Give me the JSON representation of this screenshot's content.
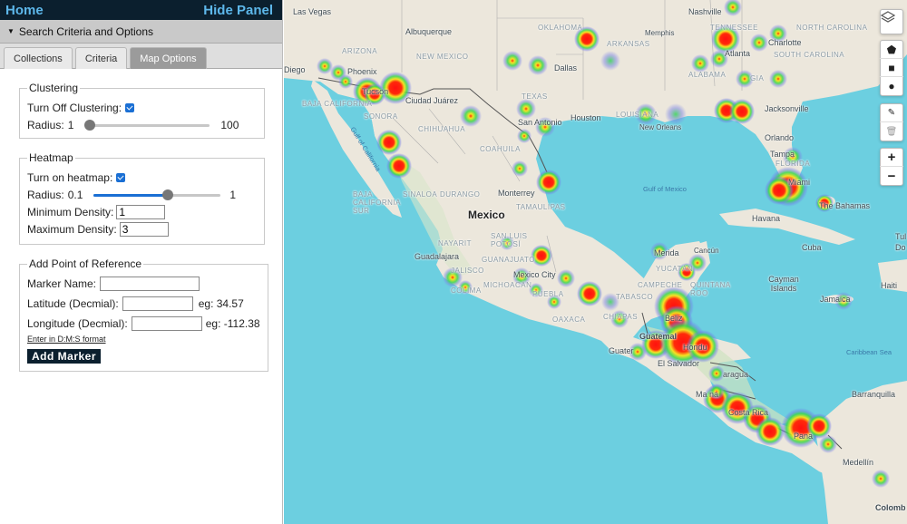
{
  "topbar": {
    "home": "Home",
    "hide_panel": "Hide Panel"
  },
  "search_header": "Search Criteria and Options",
  "tabs": [
    "Collections",
    "Criteria",
    "Map Options"
  ],
  "active_tab": 2,
  "clustering": {
    "legend": "Clustering",
    "turn_off_label": "Turn Off Clustering:",
    "turn_off_checked": true,
    "radius_label": "Radius:",
    "radius_min": "1",
    "radius_max": "100",
    "radius_value_fraction": 0.0
  },
  "heatmap": {
    "legend": "Heatmap",
    "turn_on_label": "Turn on heatmap:",
    "turn_on_checked": true,
    "radius_label": "Radius:",
    "radius_min": "0.1",
    "radius_max": "1",
    "radius_value_fraction": 0.58,
    "min_density_label": "Minimum Density:",
    "min_density_value": "1",
    "max_density_label": "Maximum Density:",
    "max_density_value": "3"
  },
  "reference": {
    "legend": "Add Point of Reference",
    "marker_name_label": "Marker Name:",
    "latitude_label": "Latitude (Decmial):",
    "latitude_eg": "eg: 34.57",
    "longitude_label": "Longitude (Decmial):",
    "longitude_eg": "eg: -112.38",
    "dms_link": "Enter in D:M:S format",
    "add_button": "Add Marker"
  },
  "map": {
    "water_color": "#6ccfe0",
    "land_color": "#ece7dc",
    "labels": {
      "las_vegas": "Las Vegas",
      "albuquerque": "Albuquerque",
      "nashville": "Nashville",
      "oklahoma": "OKLAHOMA",
      "tennessee": "TENNESSEE",
      "memphis": "Memphis",
      "north_carolina": "NORTH CAROLINA",
      "charlotte": "Charlotte",
      "arizona": "ARIZONA",
      "new_mexico": "NEW MEXICO",
      "arkansas": "ARKANSAS",
      "phoenix": "Phoenix",
      "dallas": "Dallas",
      "atlanta": "Atlanta",
      "south_carolina": "SOUTH CAROLINA",
      "alabama": "ALABAMA",
      "georgia": "GIA",
      "tucson": "Tucson",
      "ciudad_juarez": "Ciudad Juárez",
      "texas": "TEXAS",
      "diego": "Diego",
      "baja_california": "BAJA CALIFORNIA",
      "sonora": "SONORA",
      "chihuahua": "CHIHUAHUA",
      "san_antonio": "San Antonio",
      "houston": "Houston",
      "louisiana": "LOUISIANA",
      "new_orleans": "New Orleans",
      "jacksonville": "Jacksonville",
      "coahuila": "COAHUILA",
      "orlando": "Orlando",
      "gulf_of_california": "Gulf of California",
      "tampa": "Tampa",
      "florida": "FLORIDA",
      "baja_california_sur": "BAJA CALIFORNIA SUR",
      "sinaloa": "SINALOA",
      "durango": "DURANGO",
      "monterrey": "Monterrey",
      "gulf_of_mexico": "Gulf of Mexico",
      "miami": "Miami",
      "the_bahamas": "The Bahamas",
      "tamaulipas": "TAMAULIPAS",
      "mexico": "Mexico",
      "havana": "Havana",
      "cuba": "Cuba",
      "nayarit": "NAYARIT",
      "san_luis_potosi": "SAN LUIS POTOSÍ",
      "guadalajara": "Guadalajara",
      "jalisco": "JALISCO",
      "guanajuato": "GUANAJUATO",
      "merida": "Merida",
      "cancun": "Cancún",
      "yucatan": "YUCATÁN",
      "mexico_city": "Mexico City",
      "michoacan": "MICHOACÁN",
      "colima": "COLIMA",
      "puebla": "PUEBLA",
      "campeche": "CAMPECHE",
      "quintana_roo": "QUINTANA ROO",
      "tabasco": "TABASCO",
      "cayman_islands": "Cayman Islands",
      "jamaica": "Jamaica",
      "haiti": "Haiti",
      "oaxaca": "OAXACA",
      "chiapas": "CHIAPAS",
      "guatemala": "Guatemal",
      "belize": "Beliz",
      "honduras": "Hondu",
      "guater": "Guater",
      "el_salvador": "El Salvador",
      "nicaragua": "aragua",
      "caribbean_sea": "Caribbean Sea",
      "managua": "Ma na",
      "barranquilla": "Barranquilla",
      "costa_rica": "Costa Rica",
      "panama": "Pana",
      "medellin": "Medellín",
      "colombia": "Colomb",
      "tul": "Tul",
      "dom": "Do"
    }
  },
  "icons": {
    "layers": "layers-icon",
    "pentagon": "polygon-draw-icon",
    "square": "rectangle-draw-icon",
    "circle": "circle-draw-icon",
    "edit": "edit-icon",
    "trash": "trash-icon",
    "zoom_in": "zoom-in-icon",
    "zoom_out": "zoom-out-icon"
  },
  "zoom": {
    "in": "+",
    "out": "−"
  }
}
